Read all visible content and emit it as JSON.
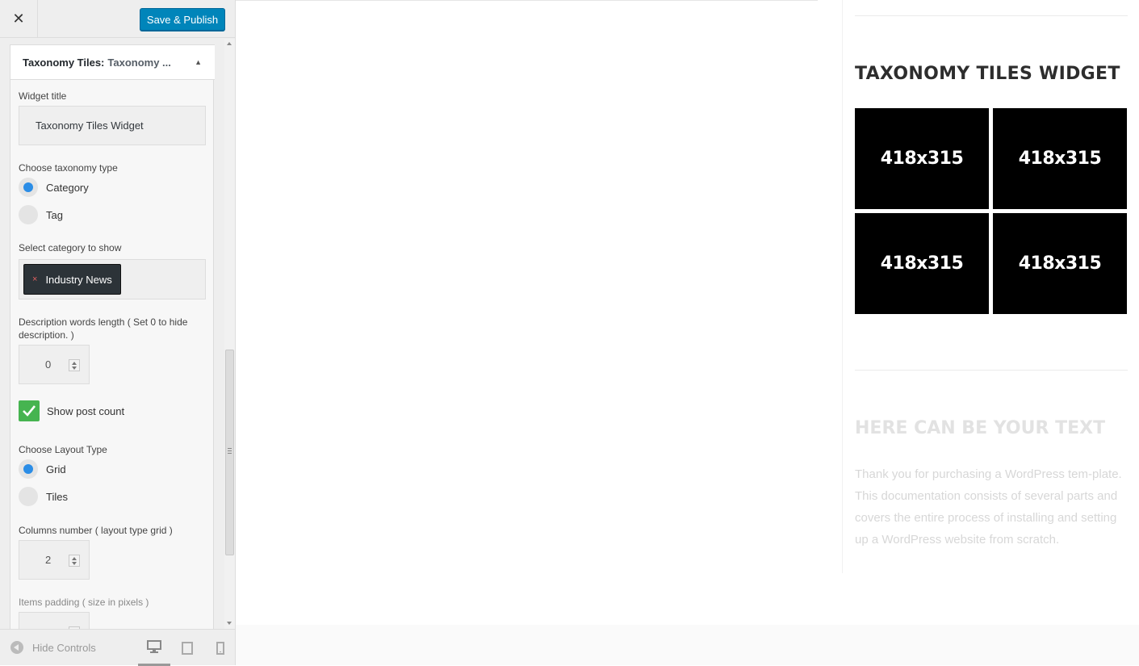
{
  "header": {
    "close_label": "✕",
    "save_label": "Save & Publish"
  },
  "widget": {
    "title_prefix": "Taxonomy Tiles:",
    "title_suffix": "Taxonomy ...",
    "fields": {
      "widget_title_label": "Widget title",
      "widget_title_value": "Taxonomy Tiles Widget",
      "taxonomy_type_label": "Choose taxonomy type",
      "taxonomy_options": [
        "Category",
        "Tag"
      ],
      "taxonomy_selected": "Category",
      "category_label": "Select category to show",
      "category_selected": "Industry News",
      "category_remove": "×",
      "desc_length_label_1": "Description words length ( Set 0 to hide",
      "desc_length_label_2": "description. )",
      "desc_length_value": "0",
      "post_count_label": "Show post count",
      "post_count_checked": true,
      "layout_label": "Choose Layout Type",
      "layout_options": [
        "Grid",
        "Tiles"
      ],
      "layout_selected": "Grid",
      "columns_label": "Columns number ( layout type grid )",
      "columns_value": "2",
      "padding_label": "Items padding ( size in pixels )"
    }
  },
  "footer": {
    "hide_controls_label": "Hide Controls",
    "devices": [
      "desktop-icon",
      "tablet-icon",
      "mobile-icon"
    ],
    "active_device": "desktop"
  },
  "preview": {
    "widget_title": "TAXONOMY TILES WIDGET",
    "tiles": [
      "418x315",
      "418x315",
      "418x315",
      "418x315"
    ],
    "text_title": "HERE CAN BE YOUR TEXT",
    "text_body": "Thank you for purchasing a WordPress tem-plate. This documentation consists of several parts and covers the entire process of installing and setting up a WordPress website from scratch."
  },
  "colors": {
    "accent": "#0085ba",
    "radio_on": "#2b8de6",
    "checkbox": "#46b450",
    "tile_bg": "#000000"
  }
}
